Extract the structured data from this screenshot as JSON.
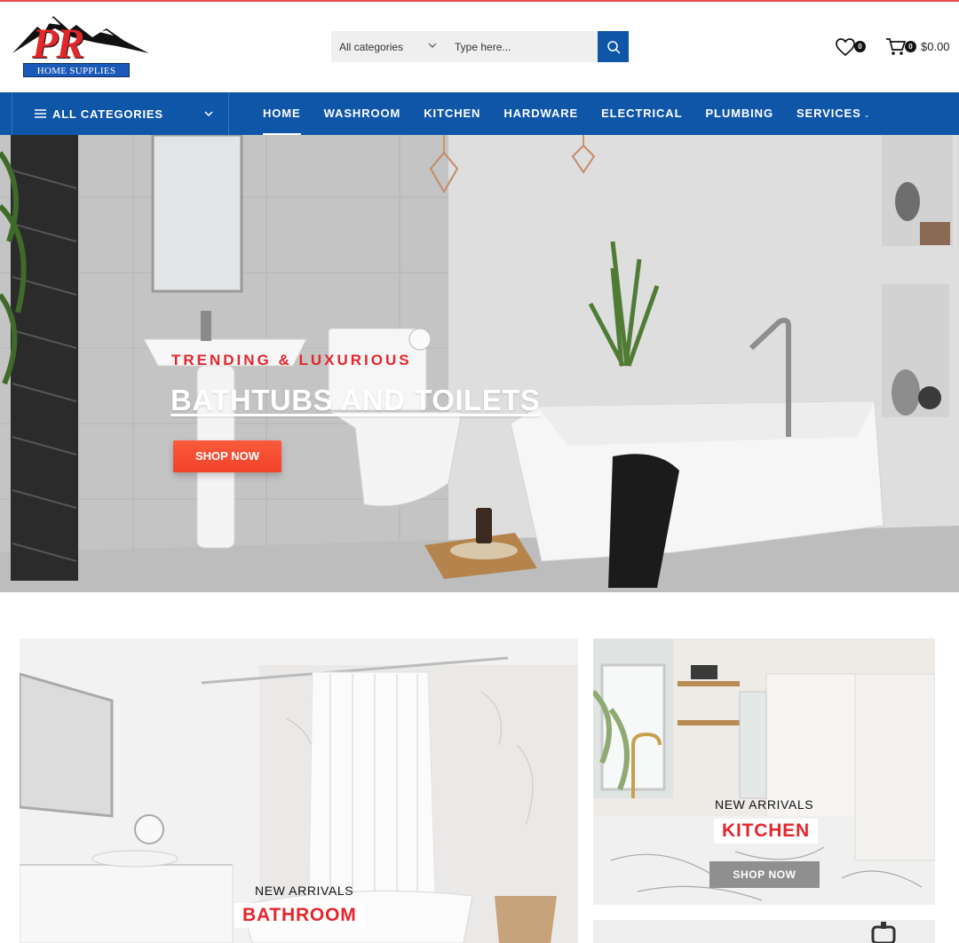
{
  "brand": {
    "logo_letters": "PR",
    "logo_caption": "HOME SUPPLIES",
    "accent_color": "#0f56a8",
    "red_color": "#e4262c"
  },
  "search": {
    "category_value": "All categories",
    "placeholder": "Type here..."
  },
  "header": {
    "wishlist_count": "0",
    "cart_count": "0",
    "cart_total": "$0.00"
  },
  "nav": {
    "all_categories_label": "ALL CATEGORIES",
    "links": [
      "HOME",
      "WASHROOM",
      "KITCHEN",
      "HARDWARE",
      "ELECTRICAL",
      "PLUMBING",
      "SERVICES"
    ]
  },
  "hero": {
    "subtitle": "TRENDING & LUXURIOUS",
    "title": "BATHTUBS AND TOILETS",
    "button": "SHOP NOW"
  },
  "banners": {
    "bathroom": {
      "tagline": "NEW ARRIVALS",
      "title": "BATHROOM"
    },
    "kitchen": {
      "tagline": "NEW ARRIVALS",
      "title": "KITCHEN",
      "button": "SHOP NOW"
    }
  }
}
